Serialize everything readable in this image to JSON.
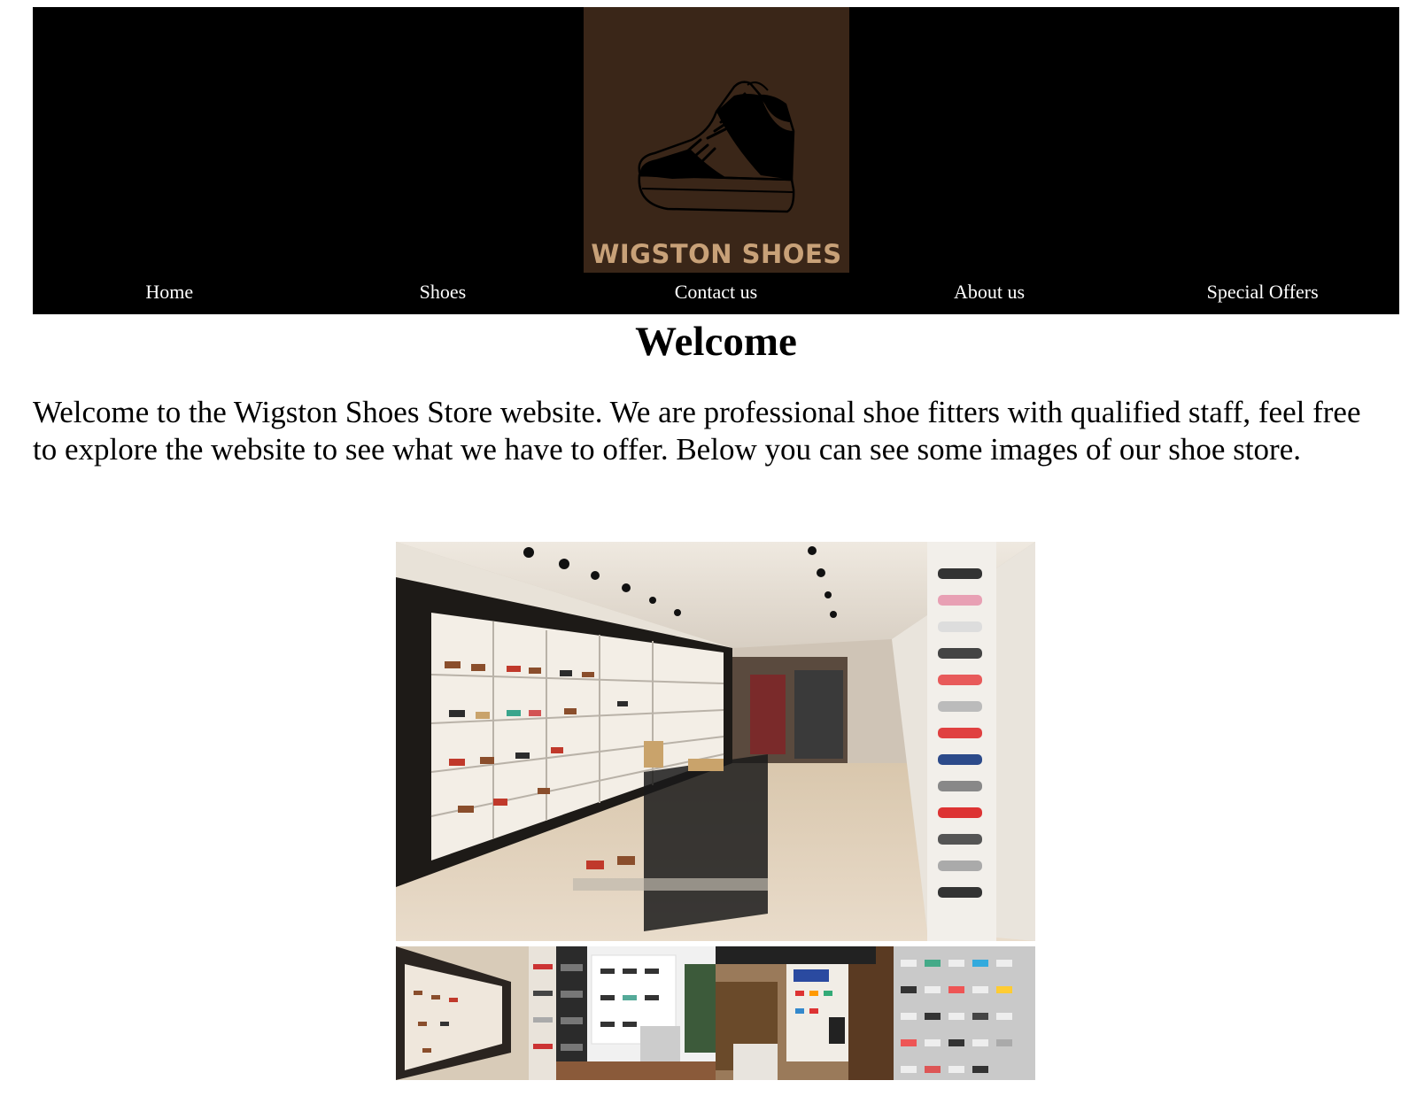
{
  "header": {
    "logo_text": "WIGSTON SHOES",
    "nav": [
      {
        "label": "Home"
      },
      {
        "label": "Shoes"
      },
      {
        "label": "Contact us"
      },
      {
        "label": "About us"
      },
      {
        "label": "Special Offers"
      }
    ]
  },
  "main": {
    "title": "Welcome",
    "intro": "Welcome to the Wigston Shoes Store website. We are professional shoe fitters with qualified staff, feel free to explore the website to see what we have to offer. Below you can see some images of our shoe store."
  },
  "colors": {
    "header_bg": "#000000",
    "logo_bg": "#3a2618",
    "logo_text": "#c8a178",
    "nav_text": "#ffffff"
  },
  "icons": [
    "sneaker-icon"
  ]
}
